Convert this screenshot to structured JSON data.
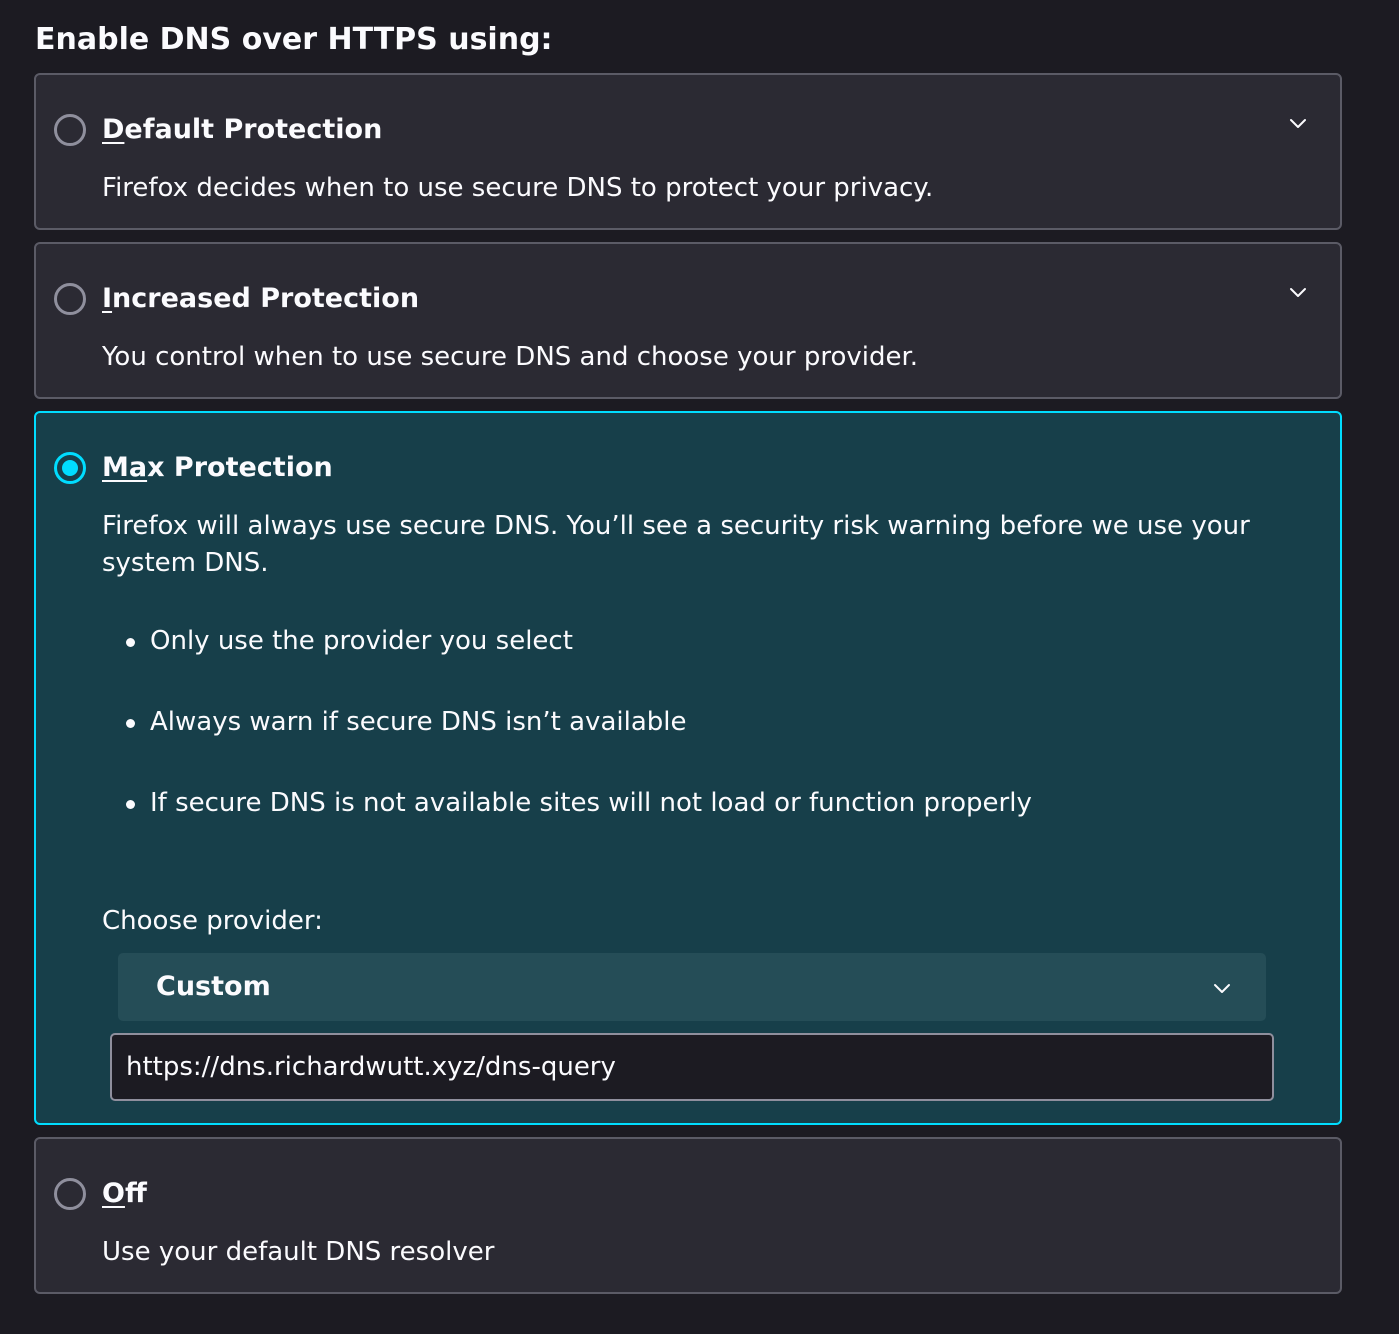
{
  "section": {
    "title": "Enable DNS over HTTPS using:"
  },
  "options": [
    {
      "access_key": "D",
      "title_rest": "efault Protection",
      "description": "Firefox decides when to use secure DNS to protect your privacy.",
      "selected": false,
      "expand_icon": "chevron-down-icon"
    },
    {
      "access_key": "I",
      "title_rest": "ncreased Protection",
      "description": "You control when to use secure DNS and choose your provider.",
      "selected": false,
      "expand_icon": "chevron-down-icon"
    },
    {
      "access_key": "Ma",
      "title_rest": "x Protection",
      "description": "Firefox will always use secure DNS. You’ll see a security risk warning before we use your system DNS.",
      "selected": true,
      "bullets": [
        "Only use the provider you select",
        "Always warn if secure DNS isn’t available",
        "If secure DNS is not available sites will not load or function properly"
      ],
      "provider_label": "Choose provider:",
      "provider_selected": "Custom",
      "custom_url": "https://dns.richardwutt.xyz/dns-query"
    },
    {
      "access_key": "O",
      "title_rest": "ff",
      "description": "Use your default DNS resolver",
      "selected": false
    }
  ],
  "colors": {
    "accent": "#00ddff",
    "selected_background": "#173f4a",
    "card_background": "#2b2a33",
    "page_background": "#1c1b22"
  }
}
